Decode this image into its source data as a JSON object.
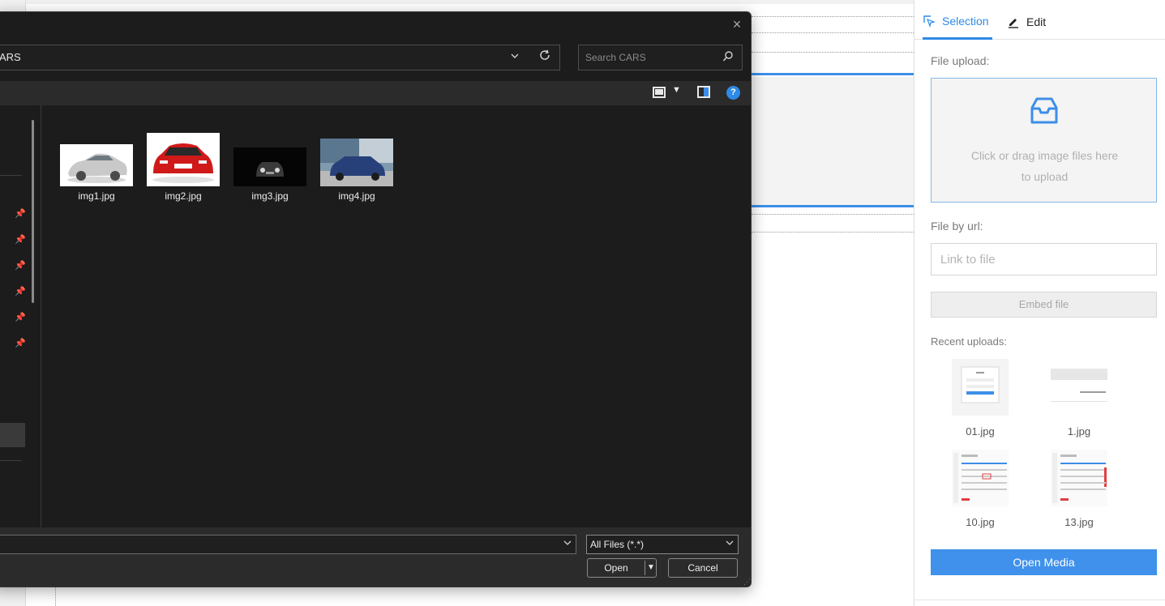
{
  "dialog": {
    "address_text": "ARS",
    "search_placeholder": "Search CARS",
    "close_glyph": "×",
    "help_glyph": "?",
    "files": [
      {
        "name": "img1.jpg",
        "thumb": "silver-car"
      },
      {
        "name": "img2.jpg",
        "thumb": "red-car"
      },
      {
        "name": "img3.jpg",
        "thumb": "dark-car"
      },
      {
        "name": "img4.jpg",
        "thumb": "blue-suv"
      }
    ],
    "filter_value": "All Files (*.*)",
    "open_label": "Open",
    "cancel_label": "Cancel"
  },
  "panel": {
    "tabs": [
      {
        "label": "Selection",
        "icon": "selection-icon",
        "active": true
      },
      {
        "label": "Edit",
        "icon": "pencil-icon",
        "active": false
      }
    ],
    "file_upload_label": "File upload:",
    "upload_hint_line1": "Click or drag image files here",
    "upload_hint_line2": "to upload",
    "file_by_url_label": "File by url:",
    "url_placeholder": "Link to file",
    "embed_label": "Embed file",
    "recent_label": "Recent uploads:",
    "recent": [
      {
        "name": "01.jpg"
      },
      {
        "name": "1.jpg"
      },
      {
        "name": "10.jpg"
      },
      {
        "name": "13.jpg"
      }
    ],
    "open_media_label": "Open Media"
  },
  "colors": {
    "accent": "#2d8ae6",
    "button_primary": "#3f91ec",
    "dialog_bg": "#1c1c1c"
  }
}
